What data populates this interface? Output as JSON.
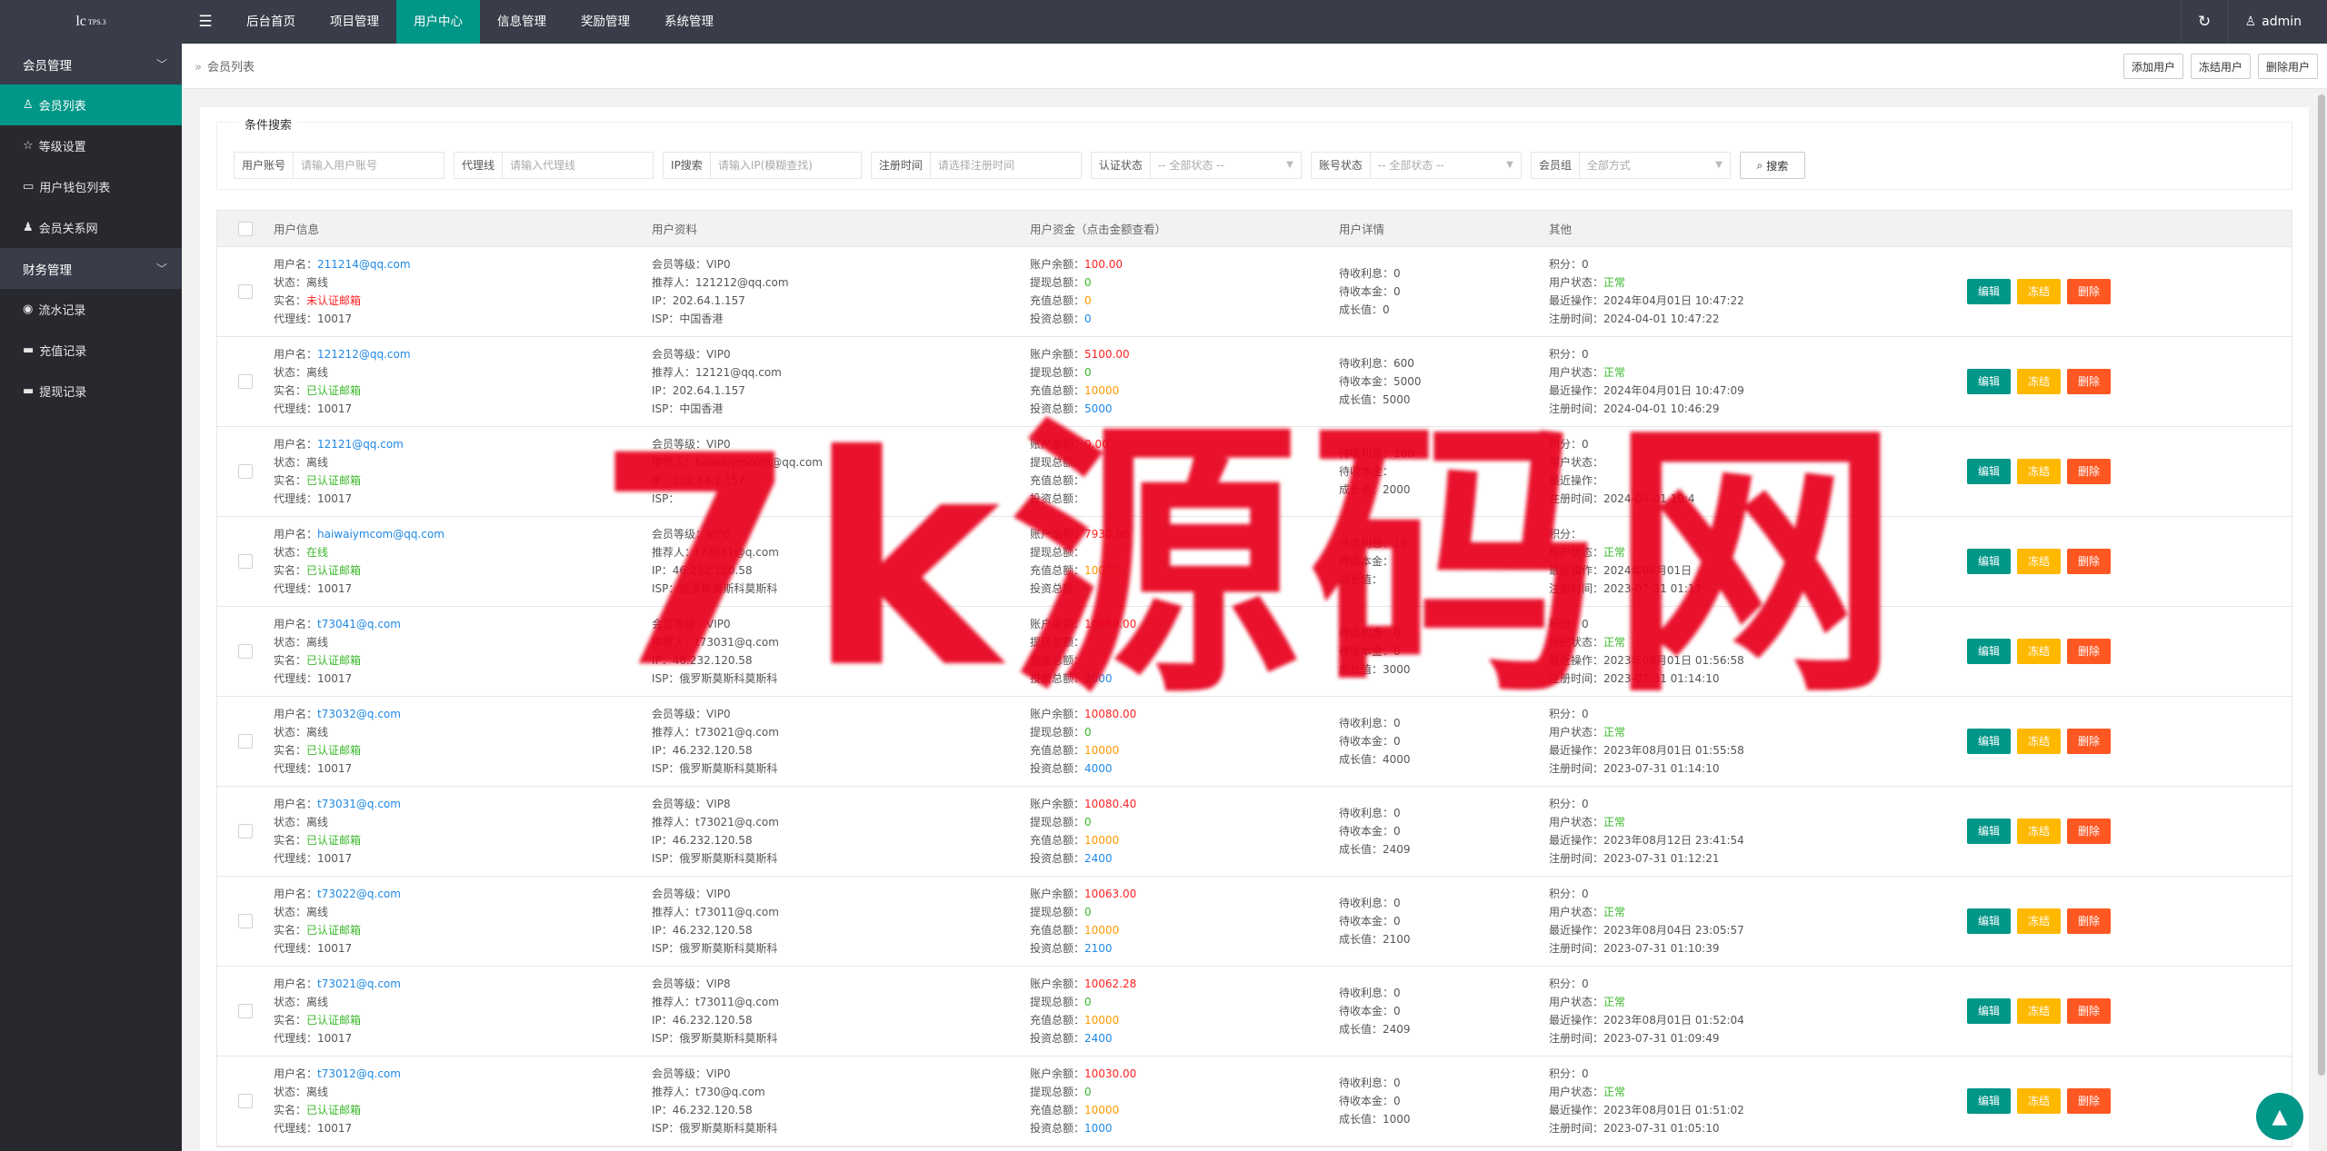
{
  "header": {
    "logo": "lc",
    "logo_sup": "TPS.3",
    "nav": [
      "后台首页",
      "项目管理",
      "用户中心",
      "信息管理",
      "奖励管理",
      "系统管理"
    ],
    "active_nav": 2,
    "admin": "admin"
  },
  "sidebar": {
    "groups": [
      {
        "label": "会员管理",
        "items": [
          {
            "icon": "user-icon",
            "glyph": "♙",
            "label": "会员列表",
            "active": true
          },
          {
            "icon": "star-icon",
            "glyph": "☆",
            "label": "等级设置",
            "active": false
          },
          {
            "icon": "wallet-icon",
            "glyph": "▭",
            "label": "用户钱包列表",
            "active": false
          },
          {
            "icon": "users-icon",
            "glyph": "♟",
            "label": "会员关系网",
            "active": false
          }
        ]
      },
      {
        "label": "财务管理",
        "items": [
          {
            "icon": "flow-icon",
            "glyph": "◉",
            "label": "流水记录",
            "active": false
          },
          {
            "icon": "card-icon",
            "glyph": "▬",
            "label": "充值记录",
            "active": false
          },
          {
            "icon": "card-icon",
            "glyph": "▬",
            "label": "提现记录",
            "active": false
          }
        ]
      }
    ]
  },
  "breadcrumb": {
    "label": "会员列表"
  },
  "toolbar": {
    "add": "添加用户",
    "freeze": "冻结用户",
    "delete": "删除用户"
  },
  "search": {
    "legend": "条件搜索",
    "fields": [
      {
        "label": "用户账号",
        "placeholder": "请输入用户账号",
        "type": "input"
      },
      {
        "label": "代理线",
        "placeholder": "请输入代理线",
        "type": "input"
      },
      {
        "label": "IP搜索",
        "placeholder": "请输入IP(模糊查找)",
        "type": "input"
      },
      {
        "label": "注册时间",
        "placeholder": "请选择注册时间",
        "type": "input"
      },
      {
        "label": "认证状态",
        "placeholder": "-- 全部状态 --",
        "type": "select"
      },
      {
        "label": "账号状态",
        "placeholder": "-- 全部状态 --",
        "type": "select"
      },
      {
        "label": "会员组",
        "placeholder": "全部方式",
        "type": "select"
      }
    ],
    "button": "搜索"
  },
  "table": {
    "headers": [
      "用户信息",
      "用户资料",
      "用户资金（点击金额查看）",
      "用户详情",
      "其他"
    ],
    "labels": {
      "username": "用户名：",
      "status": "状态：",
      "realname": "实名：",
      "agent": "代理线：",
      "level": "会员等级：",
      "referrer": "推荐人：",
      "ip": "IP：",
      "isp": "ISP：",
      "balance": "账户余额：",
      "withdraw": "提现总额：",
      "recharge": "充值总额：",
      "invest": "投资总额：",
      "pending_interest": "待收利息：",
      "pending_principal": "待收本金：",
      "growth": "成长值：",
      "points": "积分：",
      "user_state": "用户状态：",
      "last_op": "最近操作：",
      "reg_time": "注册时间："
    },
    "actions": {
      "edit": "编辑",
      "freeze": "冻结",
      "delete": "删除"
    },
    "rows": [
      {
        "username": "211214@qq.com",
        "status": "离线",
        "status_online": false,
        "realname": "未认证邮箱",
        "verified": false,
        "agent": "10017",
        "level": "VIP0",
        "referrer": "121212@qq.com",
        "ip": "202.64.1.157",
        "isp": "中国香港",
        "balance": "100.00",
        "withdraw": "0",
        "recharge": "0",
        "invest": "0",
        "pending_interest": "0",
        "pending_principal": "0",
        "growth": "0",
        "points": "0",
        "user_state": "正常",
        "last_op": "2024年04月01日 10:47:22",
        "reg_time": "2024-04-01 10:47:22"
      },
      {
        "username": "121212@qq.com",
        "status": "离线",
        "status_online": false,
        "realname": "已认证邮箱",
        "verified": true,
        "agent": "10017",
        "level": "VIP0",
        "referrer": "12121@qq.com",
        "ip": "202.64.1.157",
        "isp": "中国香港",
        "balance": "5100.00",
        "withdraw": "0",
        "recharge": "10000",
        "invest": "5000",
        "pending_interest": "600",
        "pending_principal": "5000",
        "growth": "5000",
        "points": "0",
        "user_state": "正常",
        "last_op": "2024年04月01日 10:47:09",
        "reg_time": "2024-04-01 10:46:29"
      },
      {
        "username": "12121@qq.com",
        "status": "离线",
        "status_online": false,
        "realname": "已认证邮箱",
        "verified": true,
        "agent": "10017",
        "level": "VIP0",
        "referrer": "haiwaiymcom@qq.com",
        "ip": "202.64.1.157",
        "isp": "",
        "balance": "0.00",
        "withdraw": "",
        "recharge": "",
        "invest": "",
        "pending_interest": "160",
        "pending_principal": "",
        "growth": "2000",
        "points": "0",
        "user_state": "",
        "last_op": "",
        "reg_time": "2024-04-01 10:4"
      },
      {
        "username": "haiwaiymcom@qq.com",
        "status": "在线",
        "status_online": true,
        "realname": "已认证邮箱",
        "verified": true,
        "agent": "10017",
        "level": "VIP0",
        "referrer": "t73031@q.com",
        "ip": "46.232.120.58",
        "isp": "俄罗斯莫斯科莫斯科",
        "balance": "7930.00",
        "withdraw": "",
        "recharge": "10000",
        "invest": "",
        "pending_interest": "15",
        "pending_principal": "",
        "growth": "",
        "points": "",
        "user_state": "正常",
        "last_op": "2024年04月01日",
        "reg_time": "2023-07-31 01:17"
      },
      {
        "username": "t73041@q.com",
        "status": "离线",
        "status_online": false,
        "realname": "已认证邮箱",
        "verified": true,
        "agent": "10017",
        "level": "VIP0",
        "referrer": "t73031@q.com",
        "ip": "46.232.120.58",
        "isp": "俄罗斯莫斯科莫斯科",
        "balance": "10080.00",
        "withdraw": "",
        "recharge": "",
        "invest": "3000",
        "pending_interest": "0",
        "pending_principal": "0",
        "growth": "3000",
        "points": "0",
        "user_state": "正常",
        "last_op": "2023年08月01日 01:56:58",
        "reg_time": "2023-07-31 01:14:10"
      },
      {
        "username": "t73032@q.com",
        "status": "离线",
        "status_online": false,
        "realname": "已认证邮箱",
        "verified": true,
        "agent": "10017",
        "level": "VIP0",
        "referrer": "t73021@q.com",
        "ip": "46.232.120.58",
        "isp": "俄罗斯莫斯科莫斯科",
        "balance": "10080.00",
        "withdraw": "0",
        "recharge": "10000",
        "invest": "4000",
        "pending_interest": "0",
        "pending_principal": "0",
        "growth": "4000",
        "points": "0",
        "user_state": "正常",
        "last_op": "2023年08月01日 01:55:58",
        "reg_time": "2023-07-31 01:14:10"
      },
      {
        "username": "t73031@q.com",
        "status": "离线",
        "status_online": false,
        "realname": "已认证邮箱",
        "verified": true,
        "agent": "10017",
        "level": "VIP8",
        "referrer": "t73021@q.com",
        "ip": "46.232.120.58",
        "isp": "俄罗斯莫斯科莫斯科",
        "balance": "10080.40",
        "withdraw": "0",
        "recharge": "10000",
        "invest": "2400",
        "pending_interest": "0",
        "pending_principal": "0",
        "growth": "2409",
        "points": "0",
        "user_state": "正常",
        "last_op": "2023年08月12日 23:41:54",
        "reg_time": "2023-07-31 01:12:21"
      },
      {
        "username": "t73022@q.com",
        "status": "离线",
        "status_online": false,
        "realname": "已认证邮箱",
        "verified": true,
        "agent": "10017",
        "level": "VIP0",
        "referrer": "t73011@q.com",
        "ip": "46.232.120.58",
        "isp": "俄罗斯莫斯科莫斯科",
        "balance": "10063.00",
        "withdraw": "0",
        "recharge": "10000",
        "invest": "2100",
        "pending_interest": "0",
        "pending_principal": "0",
        "growth": "2100",
        "points": "0",
        "user_state": "正常",
        "last_op": "2023年08月04日 23:05:57",
        "reg_time": "2023-07-31 01:10:39"
      },
      {
        "username": "t73021@q.com",
        "status": "离线",
        "status_online": false,
        "realname": "已认证邮箱",
        "verified": true,
        "agent": "10017",
        "level": "VIP8",
        "referrer": "t73011@q.com",
        "ip": "46.232.120.58",
        "isp": "俄罗斯莫斯科莫斯科",
        "balance": "10062.28",
        "withdraw": "0",
        "recharge": "10000",
        "invest": "2400",
        "pending_interest": "0",
        "pending_principal": "0",
        "growth": "2409",
        "points": "0",
        "user_state": "正常",
        "last_op": "2023年08月01日 01:52:04",
        "reg_time": "2023-07-31 01:09:49"
      },
      {
        "username": "t73012@q.com",
        "status": "离线",
        "status_online": false,
        "realname": "已认证邮箱",
        "verified": true,
        "agent": "10017",
        "level": "VIP0",
        "referrer": "t730@q.com",
        "ip": "46.232.120.58",
        "isp": "俄罗斯莫斯科莫斯科",
        "balance": "10030.00",
        "withdraw": "0",
        "recharge": "10000",
        "invest": "1000",
        "pending_interest": "0",
        "pending_principal": "0",
        "growth": "1000",
        "points": "0",
        "user_state": "正常",
        "last_op": "2023年08月01日 01:51:02",
        "reg_time": "2023-07-31 01:05:10"
      }
    ]
  },
  "watermark": "7k源码网",
  "colors": {
    "accent": "#009688",
    "warn": "#ffb800",
    "danger": "#ff5722",
    "header": "#393d49",
    "sidebar": "#28292f"
  }
}
